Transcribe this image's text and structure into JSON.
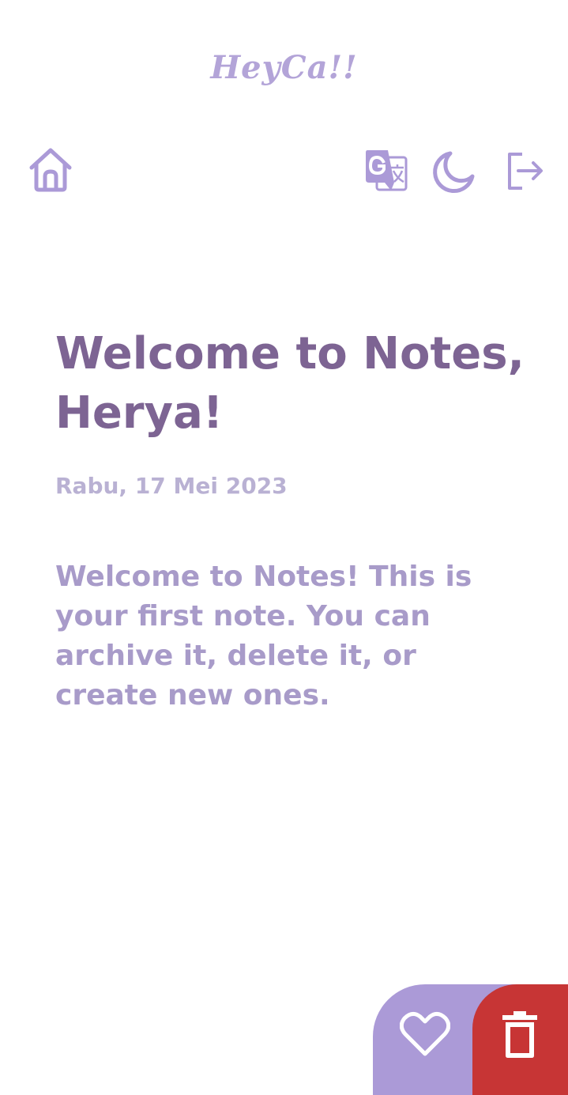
{
  "header": {
    "brand": "HeyCa!!"
  },
  "nav": {
    "home_icon": "home-icon",
    "translate_icon": "translate-icon",
    "theme_icon": "moon-icon",
    "logout_icon": "logout-icon"
  },
  "note": {
    "title": "Welcome to Notes, Herya!",
    "date": "Rabu, 17 Mei 2023",
    "body": "Welcome to Notes! This is your first note. You can archive it, delete it, or create new ones."
  },
  "actions": {
    "archive_icon": "heart-icon",
    "delete_icon": "trash-icon"
  },
  "colors": {
    "accent": "#ab9ad7",
    "title": "#7d6493",
    "date": "#b9b1d3",
    "body": "#a89bc9",
    "delete": "#c73535"
  }
}
